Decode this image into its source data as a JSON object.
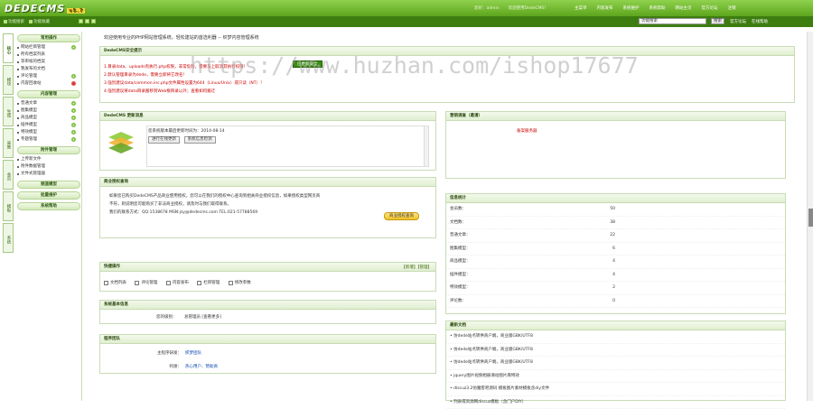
{
  "header": {
    "logo": "DEDECMS",
    "version": "v5.7",
    "user_info": [
      "您好：admin",
      "欢迎使用DedeCMS！"
    ],
    "nav": [
      "主菜单",
      "内容发布",
      "系统维护",
      "系统帮助",
      "网站主页",
      "官方论坛",
      "注销"
    ],
    "sub_left": [
      "功能搜索",
      "功能收藏"
    ],
    "search_placeholder": "功能搜索",
    "search_button": "搜索",
    "links": [
      "官方论坛",
      "在线帮助"
    ]
  },
  "vtabs": [
    "核心",
    "模块",
    "生成",
    "采集",
    "会员",
    "模板",
    "系统"
  ],
  "sidebar": {
    "groups": [
      {
        "title": "常用操作",
        "items": [
          {
            "label": "网站栏目管理",
            "mark": "plus"
          },
          {
            "label": "所有档案列表",
            "mark": ""
          },
          {
            "label": "等审核的档案",
            "mark": ""
          },
          {
            "label": "我发布的文档",
            "mark": ""
          },
          {
            "label": "评论管理",
            "mark": "plus"
          },
          {
            "label": "内容回收站",
            "mark": "red"
          }
        ]
      },
      {
        "title": "内容管理",
        "items": [
          {
            "label": "普通文章",
            "mark": "plus"
          },
          {
            "label": "图集模型",
            "mark": "plus"
          },
          {
            "label": "商品模型",
            "mark": "plus"
          },
          {
            "label": "插件模型",
            "mark": "plus"
          },
          {
            "label": "特效模型",
            "mark": "plus"
          },
          {
            "label": "专题管理",
            "mark": "plus"
          }
        ]
      },
      {
        "title": "附件管理",
        "items": [
          {
            "label": "上传新文件",
            "mark": ""
          },
          {
            "label": "附件数据管理",
            "mark": ""
          },
          {
            "label": "文件式管理器",
            "mark": ""
          }
        ]
      },
      {
        "title": "频道模型",
        "items": []
      },
      {
        "title": "批量维护",
        "items": []
      },
      {
        "title": "系统帮助",
        "items": []
      }
    ]
  },
  "welcome": "欢迎使用专业的PHP网站管理系统，轻松建站的首选利器 -- 织梦内容管理系统",
  "security": {
    "title": "DedeCMS安全提示",
    "button": "已更新安全",
    "items": [
      "1.目录data、uploads有执行.php权限，非常危险，需要马上取消其执行权限！",
      "2.默认管理目录为dede，需要立即将它改名！",
      "3.强烈建议data/common.inc.php文件属性设置为644（Linux/Unix）或只读（NT）！",
      "4.强烈建议将data目录搬移到Web根目录以外；查看如何搬迁"
    ],
    "link": "查看如何搬迁"
  },
  "update": {
    "title": "DedeCMS 更新消息",
    "date_label": "您系统版本最后更新时间为：2014-08-14",
    "btn_check": "进行在线更新",
    "btn_info": "系统信息检测"
  },
  "info": {
    "title": "营销调查（邀请）",
    "link": "备案服务器"
  },
  "license": {
    "title": "商业授权查询",
    "text1": "如果您已购买DedeCMS产品商业使用授权，您可以在我们的授权中心查询到相关商业授权信息，如果授权类型网页商",
    "text2": "不符，则说明您可能购买了非法商业授权，请及时与我们取得联系。",
    "contact": "我们的联系方式：QQ:1538678 MSN:jsy@dedecms.com TEL:021-57788569",
    "button": "商业授权查询"
  },
  "stats": {
    "title": "信息统计",
    "rows": [
      {
        "label": "会员数：",
        "value": "50"
      },
      {
        "label": "文档数：",
        "value": "38"
      },
      {
        "label": "普通文章：",
        "value": "22"
      },
      {
        "label": "图集模型：",
        "value": "6"
      },
      {
        "label": "商品模型：",
        "value": "4"
      },
      {
        "label": "插件模型：",
        "value": "4"
      },
      {
        "label": "特效模型：",
        "value": "2"
      },
      {
        "label": "评论数：",
        "value": "0"
      }
    ]
  },
  "quick": {
    "title": "快捷操作",
    "actions": "【新增】【管理】",
    "links": [
      "文档列表",
      "评论管理",
      "内容发布",
      "栏目管理",
      "修改参数"
    ]
  },
  "sysinfo": {
    "title": "系统基本信息",
    "label": "您的级别：",
    "value": "总管理员 [查看更多]"
  },
  "team": {
    "title": "程序团队",
    "lead_label": "主程序研发：",
    "lead_value": "织梦团队",
    "thanks_label": "鸣谢：",
    "thanks_value": "热心用户、赞助商"
  },
  "docs": {
    "title": "最新文档",
    "items": [
      "仿dede站点转供商户端，商业版GBK/UTF8",
      "仿dede站点转供商户端，商业版GBK/UTF8",
      "仿dede站点转供商户端，商业版GBK/UTF8",
      "jquery图片视频相册滑动图片库特效",
      "discuz3.2仿魔客吧源码 模板图片素材模板含diy文件",
      "列表或资源网discuz模板（含门户DIY）"
    ]
  },
  "watermark": "https://www.huzhan.com/ishop17677"
}
